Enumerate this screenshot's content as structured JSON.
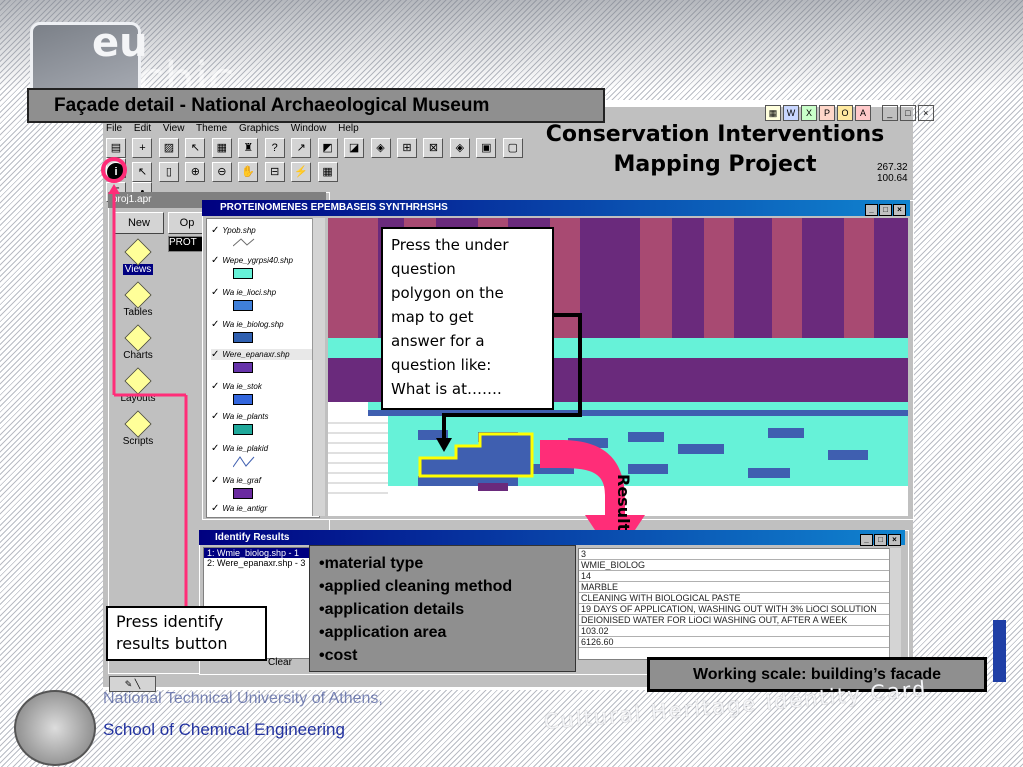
{
  "slide": {
    "title_caption": "Façade detail - National Archaeological Museum",
    "project_title_line1": "Conservation Interventions",
    "project_title_line2": "Mapping Project",
    "logo_text": "eu",
    "logo_text2": "chic"
  },
  "app": {
    "menu": [
      "File",
      "Edit",
      "View",
      "Theme",
      "Graphics",
      "Window",
      "Help"
    ],
    "coords_x": "267.32",
    "coords_y": "100.64",
    "project_window_title": "proj1.apr",
    "new_button": "New",
    "open_button": "Op",
    "project_right_text": "PROT",
    "project_items": [
      "Views",
      "Tables",
      "Charts",
      "Layouts",
      "Scripts"
    ]
  },
  "view": {
    "title": "PROTEINOMENES EPEMBASEIS SYNTHRHSHS",
    "legend": [
      {
        "label": "Ypob.shp",
        "color": "line"
      },
      {
        "label": "Wepe_ygrpsi40.shp",
        "color": "#66f2d8"
      },
      {
        "label": "Wa ie_lioci.shp",
        "color": "#3f7fd9"
      },
      {
        "label": "Wa ie_biolog.shp",
        "color": "#2f5fb0"
      },
      {
        "label": "Were_epanaxr.shp",
        "color": "#6633aa"
      },
      {
        "label": "Wa ie_stok",
        "color": "#3366dd"
      },
      {
        "label": "Wa ie_plants",
        "color": "#1fa89a"
      },
      {
        "label": "Wa ie_plakid",
        "color": "line"
      },
      {
        "label": "Wa ie_graf",
        "color": "#6a2aa0"
      },
      {
        "label": "Wa ie_antigr",
        "color": "#66f2d8"
      }
    ]
  },
  "callout": {
    "lines": [
      "Press the under",
      "question",
      "polygon on the",
      "map to get",
      "answer for a",
      "question like:",
      "What is at……."
    ]
  },
  "results_label": "Results",
  "identify": {
    "title": "Identify Results",
    "list": [
      "1: Wmie_biolog.shp - 1",
      "2: Were_epanaxr.shp - 3"
    ],
    "values": [
      "3",
      "WMIE_BIOLOG",
      "14",
      "MARBLE",
      "CLEANING WITH BIOLOGICAL PASTE",
      "19 DAYS OF APPLICATION, WASHING OUT WITH 3% LiOCl SOLUTION",
      "DEIONISED WATER FOR LiOCl WASHING OUT, AFTER A WEEK",
      "103.02",
      "6126.60"
    ],
    "clear_button": "Clear"
  },
  "info_box": [
    "•material type",
    "•applied cleaning method",
    "•application details",
    "•application area",
    "•cost"
  ],
  "press_box": [
    "Press identify",
    "results button"
  ],
  "scale_box": "Working scale: building’s facade",
  "footer": {
    "university": "National Technical University of Athens,",
    "school": "School of Chemical Engineering",
    "brand": "Cultural  Heritage  Identity  Card"
  },
  "colors": {
    "pink_arrow": "#ff2d78",
    "purple": "#6a2a7c",
    "cyan": "#66f2d8",
    "blue": "#3f7fd9",
    "highlight": "#ffff00"
  }
}
